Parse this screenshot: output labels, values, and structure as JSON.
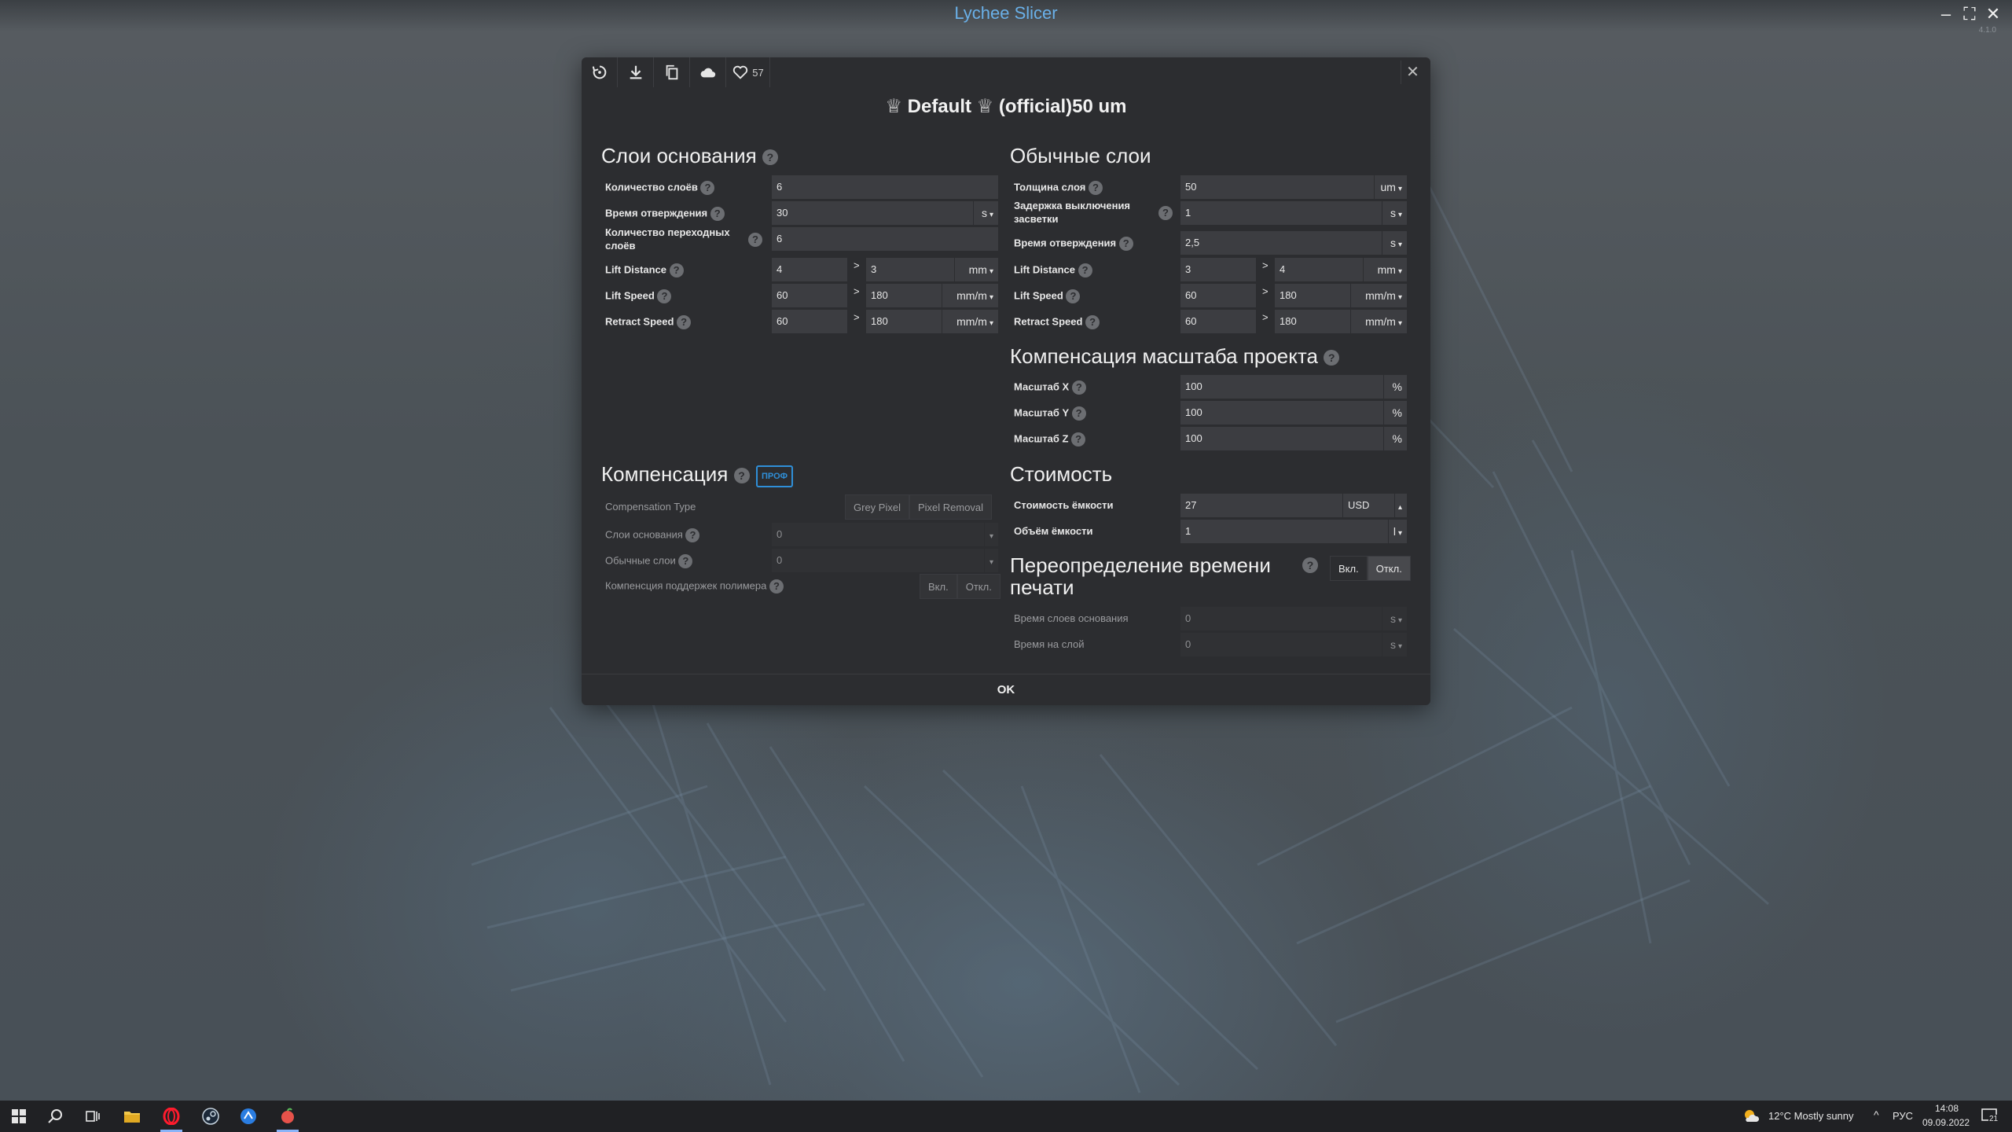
{
  "app": {
    "title": "Lychee Slicer",
    "version": "4.1.0"
  },
  "toolbar": {
    "like_count": "57"
  },
  "profile": {
    "title": "♕ Default ♕ (official)50 um"
  },
  "base_layers": {
    "title": "Слои основания",
    "rows": {
      "layer_count": {
        "label": "Количество слоёв",
        "value": "6"
      },
      "cure_time": {
        "label": "Время отверждения",
        "value": "30",
        "unit": "s"
      },
      "transition_layers": {
        "label": "Количество переходных слоёв",
        "value": "6"
      },
      "lift_distance": {
        "label": "Lift Distance",
        "v1": "4",
        "v2": "3",
        "unit": "mm"
      },
      "lift_speed": {
        "label": "Lift Speed",
        "v1": "60",
        "v2": "180",
        "unit": "mm/m"
      },
      "retract_speed": {
        "label": "Retract Speed",
        "v1": "60",
        "v2": "180",
        "unit": "mm/m"
      }
    }
  },
  "normal_layers": {
    "title": "Обычные слои",
    "rows": {
      "layer_height": {
        "label": "Толщина слоя",
        "value": "50",
        "unit": "um"
      },
      "light_off_delay": {
        "label": "Задержка выключения засветки",
        "value": "1",
        "unit": "s"
      },
      "cure_time": {
        "label": "Время отверждения",
        "value": "2,5",
        "unit": "s"
      },
      "lift_distance": {
        "label": "Lift Distance",
        "v1": "3",
        "v2": "4",
        "unit": "mm"
      },
      "lift_speed": {
        "label": "Lift Speed",
        "v1": "60",
        "v2": "180",
        "unit": "mm/m"
      },
      "retract_speed": {
        "label": "Retract Speed",
        "v1": "60",
        "v2": "180",
        "unit": "mm/m"
      }
    }
  },
  "scale_comp": {
    "title": "Компенсация масштаба проекта",
    "rows": {
      "x": {
        "label": "Масштаб X",
        "value": "100",
        "unit": "%"
      },
      "y": {
        "label": "Масштаб Y",
        "value": "100",
        "unit": "%"
      },
      "z": {
        "label": "Масштаб Z",
        "value": "100",
        "unit": "%"
      }
    }
  },
  "compensation": {
    "title": "Компенсация",
    "badge": "ПРОФ",
    "type_label": "Compensation Type",
    "type_opt1": "Grey Pixel",
    "type_opt2": "Pixel Removal",
    "base_label": "Слои основания",
    "base_value": "0",
    "normal_label": "Обычные слои",
    "normal_value": "0",
    "support_label": "Компенсция поддержек полимера",
    "on": "Вкл.",
    "off": "Откл."
  },
  "cost": {
    "title": "Стоимость",
    "bottle_cost_label": "Стоимость ёмкости",
    "bottle_cost_value": "27",
    "currency": "USD",
    "bottle_volume_label": "Объём ёмкости",
    "bottle_volume_value": "1",
    "volume_unit": "l"
  },
  "print_time": {
    "title": "Переопределение времени печати",
    "on": "Вкл.",
    "off": "Откл.",
    "base_label": "Время слоев основания",
    "base_value": "0",
    "base_unit": "s",
    "layer_label": "Время на слой",
    "layer_value": "0",
    "layer_unit": "s"
  },
  "footer": {
    "ok": "OK"
  },
  "taskbar": {
    "weather": "12°C  Mostly sunny",
    "lang": "РУС",
    "time": "14:08",
    "date": "09.09.2022",
    "notifications": "21"
  }
}
